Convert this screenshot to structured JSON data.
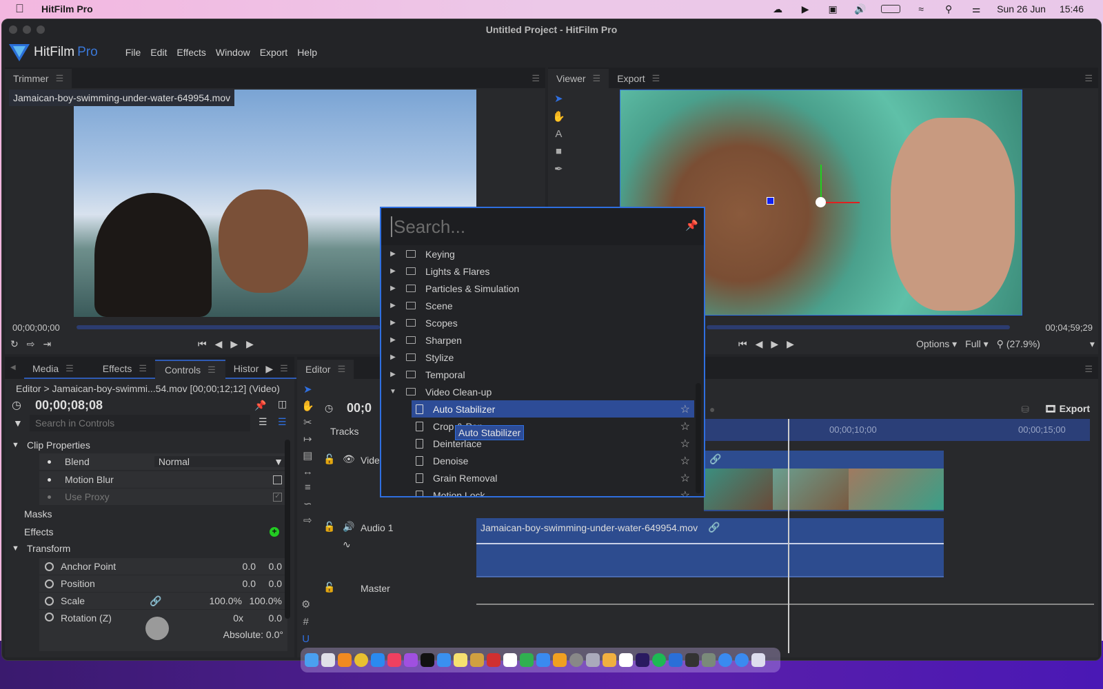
{
  "menubar": {
    "app_name": "HitFilm Pro",
    "date": "Sun 26 Jun",
    "time": "15:46",
    "icons": [
      "creative-cloud-icon",
      "play-circle-icon",
      "screen-icon",
      "volume-icon",
      "battery-icon",
      "wifi-icon",
      "spotlight-search-icon",
      "control-center-icon"
    ]
  },
  "window": {
    "title": "Untitled Project - HitFilm Pro",
    "logo_main": "HitFilm",
    "logo_suffix": "Pro",
    "menu": [
      "File",
      "Edit",
      "Effects",
      "Window",
      "Export",
      "Help"
    ]
  },
  "trimmer": {
    "tab": "Trimmer",
    "filename": "Jamaican-boy-swimming-under-water-649954.mov",
    "timecode": "00;00;00;00"
  },
  "viewer": {
    "tabs": [
      "Viewer",
      "Export"
    ],
    "end_timecode": "00;04;59;29",
    "options_label": "Options",
    "quality_label": "Full",
    "zoom_label": "(27.9%)"
  },
  "controls_panel": {
    "tabs": [
      "Media",
      "Effects",
      "Controls",
      "Histor"
    ],
    "active_tab": "Controls",
    "breadcrumb": "Editor > Jamaican-boy-swimmi...54.mov [00;00;12;12] (Video)",
    "timecode": "00;00;08;08",
    "search_placeholder": "Search in Controls",
    "clip_properties_label": "Clip Properties",
    "blend_label": "Blend",
    "blend_value": "Normal",
    "motion_blur_label": "Motion Blur",
    "motion_blur_checked": false,
    "use_proxy_label": "Use Proxy",
    "use_proxy_checked": true,
    "masks_label": "Masks",
    "effects_label": "Effects",
    "transform_label": "Transform",
    "transform": [
      {
        "name": "Anchor Point",
        "v1": "0.0",
        "v2": "0.0"
      },
      {
        "name": "Position",
        "v1": "0.0",
        "v2": "0.0"
      },
      {
        "name": "Scale",
        "v1": "100.0%",
        "v2": "100.0%"
      },
      {
        "name": "Rotation (Z)",
        "v1": "0x",
        "v2": "0.0"
      }
    ],
    "rotation_absolute": "Absolute: 0.0°"
  },
  "editor": {
    "tab": "Editor",
    "timecode_partial": "00;0",
    "tracks_label": "Tracks",
    "video_track": "Vide",
    "audio_track": "Audio 1",
    "master_track": "Master",
    "export_label": "Export",
    "ruler": [
      "00;00;10;00",
      "00;00;15;00"
    ],
    "audio_clip_name": "Jamaican-boy-swimming-under-water-649954.mov"
  },
  "effects_popup": {
    "search_placeholder": "Search...",
    "folders": [
      "Keying",
      "Lights & Flares",
      "Particles & Simulation",
      "Scene",
      "Scopes",
      "Sharpen",
      "Stylize",
      "Temporal"
    ],
    "expanded_folder": "Video Clean-up",
    "items": [
      "Auto Stabilizer",
      "Crop & Pan",
      "Deinterlace",
      "Denoise",
      "Grain Removal",
      "Motion Lock"
    ],
    "selected_item": "Auto Stabilizer",
    "tooltip": "Auto Stabilizer"
  },
  "colors": {
    "accent": "#2f6fe0",
    "selection": "#2d4c97",
    "clip": "#2d4c8f",
    "add_green": "#22cc22"
  }
}
